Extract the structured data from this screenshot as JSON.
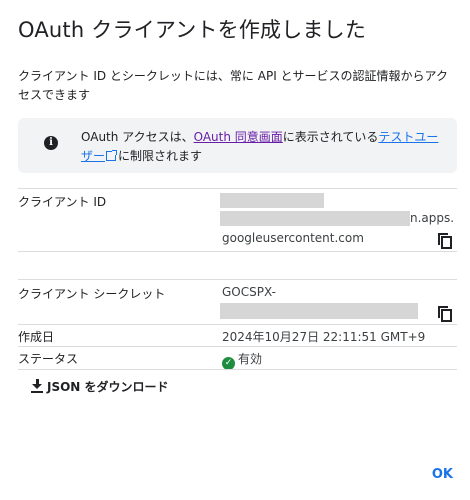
{
  "dialog": {
    "title": "OAuth クライアントを作成しました",
    "description": "クライアント ID とシークレットには、常に API とサービスの認証情報からアクセスできます"
  },
  "info": {
    "icon": "info-icon",
    "prefix": "OAuth アクセスは、",
    "consent_link": "OAuth 同意画面",
    "middle": "に表示されている",
    "test_users_link_1": "テストユー",
    "test_users_link_2": "ザー",
    "suffix": "に制限されます"
  },
  "fields": {
    "client_id_label": "クライアント ID",
    "client_id_suffix": "n.apps.",
    "client_id_line3": "googleusercontent.com",
    "secret_label": "クライアント シークレット",
    "secret_prefix": "GOCSPX-",
    "created_label": "作成日",
    "created_value": "2024年10月27日 22:11:51 GMT+9",
    "status_label": "ステータス",
    "status_value": "有効"
  },
  "actions": {
    "download_label": "JSON をダウンロード",
    "ok_label": "OK"
  },
  "colors": {
    "accent": "#1a73e8",
    "visited_link": "#681da8",
    "status_green": "#1e8e3e"
  }
}
